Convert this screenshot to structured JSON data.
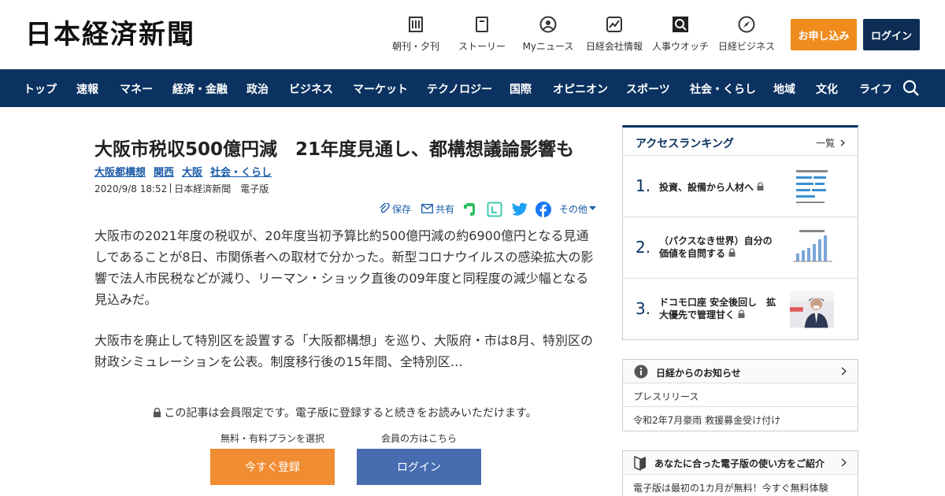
{
  "header": {
    "logo": "日本経済新聞",
    "nav": [
      {
        "label": "朝刊・夕刊",
        "icon": "newspaper-icon"
      },
      {
        "label": "ストーリー",
        "icon": "book-icon"
      },
      {
        "label": "Myニュース",
        "icon": "user-icon"
      },
      {
        "label": "日経会社情報",
        "icon": "chart-icon"
      },
      {
        "label": "人事ウオッチ",
        "icon": "magnifier-icon"
      },
      {
        "label": "日経ビジネス",
        "icon": "compass-icon"
      }
    ],
    "apply_label": "お申し込み",
    "login_label": "ログイン"
  },
  "navbar": {
    "items": [
      "トップ",
      "速報",
      "マネー",
      "経済・金融",
      "政治",
      "ビジネス",
      "マーケット",
      "テクノロジー",
      "国際",
      "オピニオン",
      "スポーツ",
      "社会・くらし",
      "地域",
      "文化",
      "ライフ"
    ]
  },
  "article": {
    "title": "大阪市税収500億円減　21年度見通し、都構想議論影響も",
    "tags": [
      "大阪都構想",
      "関西",
      "大阪",
      "社会・くらし"
    ],
    "date": "2020/9/8 18:52",
    "source": "日本経済新聞　電子版",
    "share": {
      "save": "保存",
      "share": "共有",
      "more": "その他"
    },
    "paragraph1": "大阪市の2021年度の税収が、20年度当初予算比約500億円減の約6900億円となる見通しであることが8日、市関係者への取材で分かった。新型コロナウイルスの感染拡大の影響で法人市民税などが減り、リーマン・ショック直後の09年度と同程度の減少幅となる見込みだ。",
    "paragraph2": "大阪市を廃止して特別区を設置する「大阪都構想」を巡り、大阪府・市は8月、特別区の財政シミュレーションを公表。制度移行後の15年間、全特別区…",
    "paywall_note": "この記事は会員限定です。電子版に登録すると続きをお読みいただけます。",
    "register_sub": "無料・有料プランを選択",
    "register_label": "今すぐ登録",
    "login_sub": "会員の方はこちら",
    "login_label": "ログイン"
  },
  "ranking": {
    "title": "アクセスランキング",
    "more": "一覧",
    "items": [
      {
        "num": "1.",
        "text": "投資、設備から人材へ"
      },
      {
        "num": "2.",
        "text": "（パクスなき世界）自分の価値を自問する"
      },
      {
        "num": "3.",
        "text": "ドコモ口座 安全後回し　拡大優先で管理甘く"
      }
    ]
  },
  "notice": {
    "title": "日経からのお知らせ",
    "items": [
      "プレスリリース",
      "令和2年7月豪雨 救援募金受け付け"
    ]
  },
  "guide": {
    "title": "あなたに合った電子版の使い方をご紹介",
    "text": "電子版は最初の1カ月が無料！今すぐ無料体験"
  },
  "colors": {
    "navy": "#0b3260",
    "orange": "#f08c1e",
    "link": "#1a5aa8",
    "login_blue": "#476db0"
  }
}
